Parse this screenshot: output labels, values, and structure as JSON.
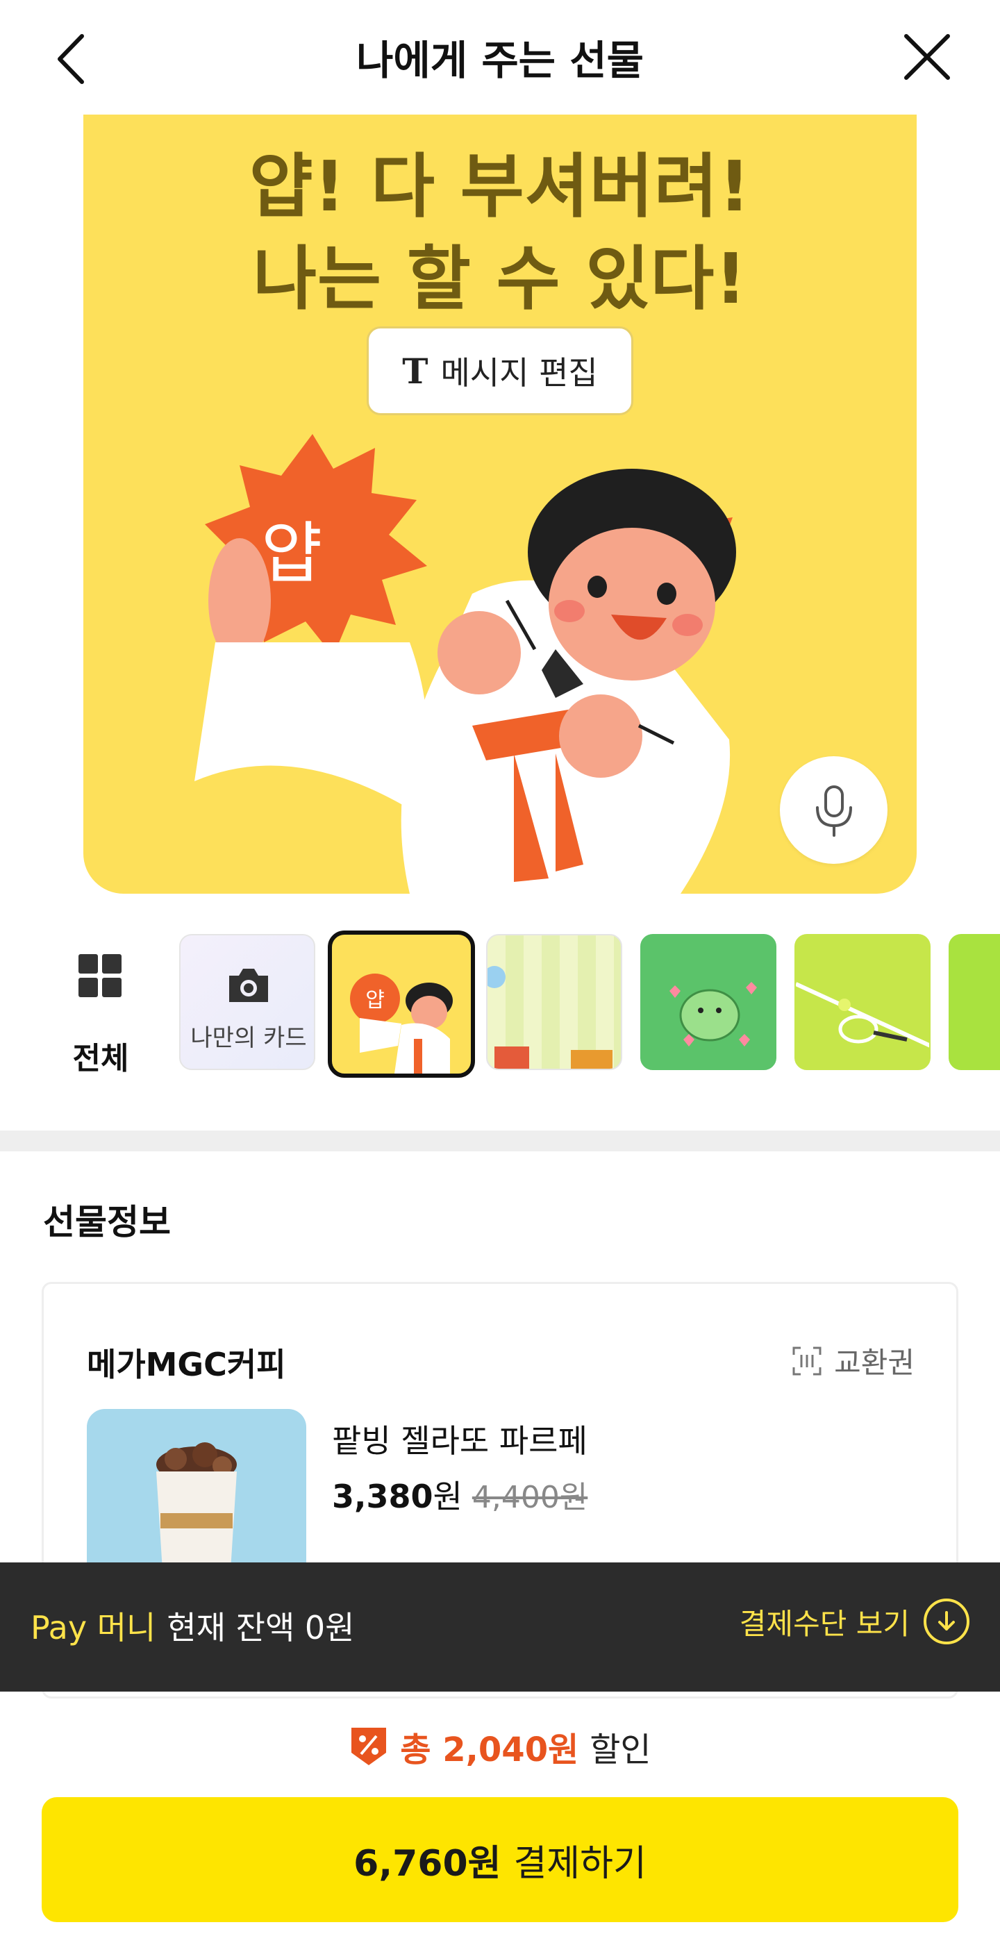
{
  "header": {
    "title": "나에게 주는 선물"
  },
  "card": {
    "message_line1": "얍! 다 부셔버려!",
    "message_line2": "나는 할 수 있다!",
    "edit_button_label": "메시지 편집",
    "illustration_text": "얍",
    "background_color": "#fde05a"
  },
  "templates": {
    "all_label": "전체",
    "my_card_label": "나만의 카드",
    "selected_thumb_text": "얍"
  },
  "gift_info": {
    "section_title": "선물정보",
    "brand": "메가MGC커피",
    "voucher_label": "교환권",
    "product_name": "팥빙 젤라또 파르페",
    "price_now": "3,380",
    "price_unit": "원",
    "price_original": "4,400원"
  },
  "pay_bar": {
    "brand": "Pay 머니",
    "balance_text": "현재 잔액 0원",
    "view_methods": "결제수단 보기"
  },
  "summary": {
    "discount_amount": "총 2,040원",
    "discount_suffix": "할인",
    "pay_amount": "6,760원",
    "pay_label": "결제하기"
  },
  "colors": {
    "accent_yellow": "#fee500",
    "discount_orange": "#e8541e",
    "pay_bar_bg": "#2c2c2c"
  }
}
